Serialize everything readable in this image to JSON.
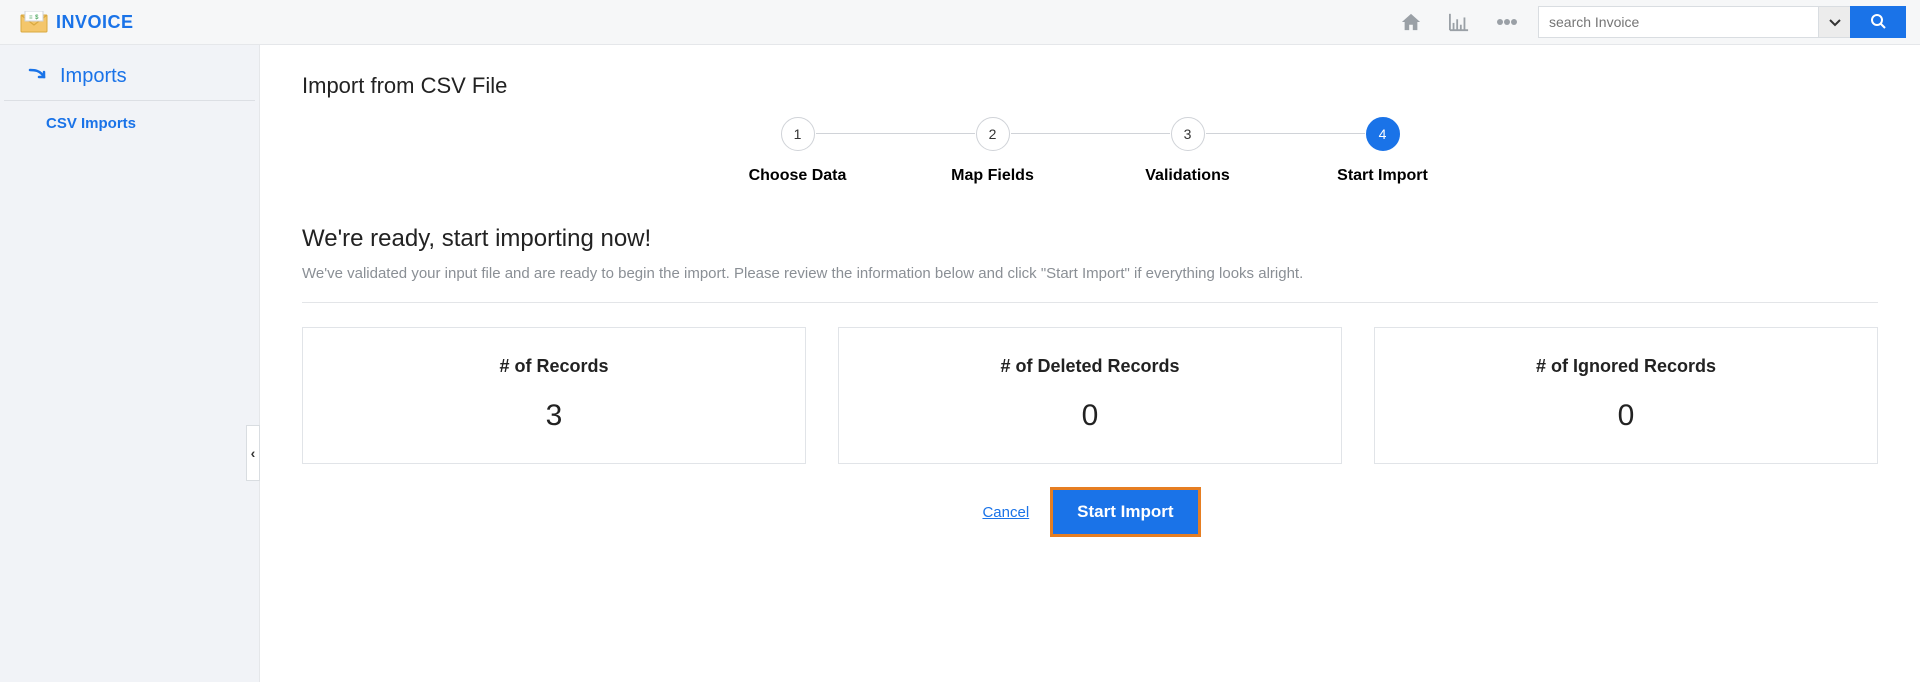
{
  "header": {
    "brand": "INVOICE",
    "search_placeholder": "search Invoice"
  },
  "sidebar": {
    "group_title": "Imports",
    "items": [
      {
        "label": "CSV Imports"
      }
    ]
  },
  "main": {
    "page_title": "Import from CSV File",
    "steps": [
      {
        "num": "1",
        "label": "Choose Data"
      },
      {
        "num": "2",
        "label": "Map Fields"
      },
      {
        "num": "3",
        "label": "Validations"
      },
      {
        "num": "4",
        "label": "Start Import",
        "active": true
      }
    ],
    "ready_title": "We're ready, start importing now!",
    "ready_desc": "We've validated your input file and are ready to begin the import. Please review the information below and click \"Start Import\" if everything looks alright.",
    "cards": [
      {
        "title": "# of Records",
        "value": "3"
      },
      {
        "title": "# of Deleted Records",
        "value": "0"
      },
      {
        "title": "# of Ignored Records",
        "value": "0"
      }
    ],
    "actions": {
      "cancel": "Cancel",
      "start": "Start Import"
    }
  }
}
